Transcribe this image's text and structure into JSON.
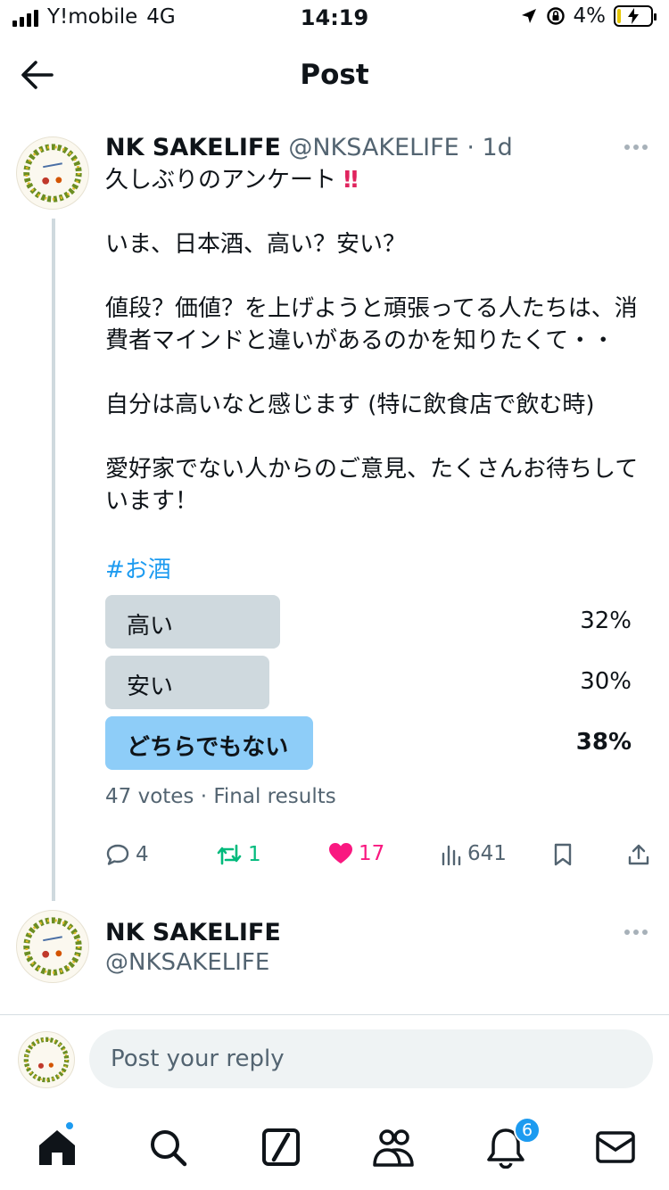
{
  "status_bar": {
    "carrier": "Y!mobile",
    "network": "4G",
    "time": "14:19",
    "battery": "4%"
  },
  "header": {
    "title": "Post",
    "back_icon": "arrow-left-icon"
  },
  "tweet": {
    "name": "NK SAKELIFE",
    "handle": "@NKSAKELIFE",
    "time": "· 1d",
    "lines": [
      "久しぶりのアンケート",
      "いま、日本酒、高い？安い？",
      "値段？価値？を上げようと頑張ってる人たちは、消",
      "費者マインドと違いがあるのかを知りたくて・・",
      "自分は高いなと感じます (特に飲食店で飲む時)",
      "愛好家でない人からのご意見、たくさんお待ちして",
      "います！"
    ],
    "emoji_mark": "‼",
    "hashtag": "#お酒",
    "poll": {
      "options": [
        {
          "label": "高い",
          "percent": "32%",
          "fraction": 0.32
        },
        {
          "label": "安い",
          "percent": "30%",
          "fraction": 0.3
        },
        {
          "label": "どちらでもない",
          "percent": "38%",
          "fraction": 0.38
        }
      ],
      "winner_index": 2,
      "meta": "47 votes · Final results"
    },
    "actions": {
      "replies": "4",
      "reposts": "1",
      "likes": "17",
      "views": "641"
    }
  },
  "tweet2": {
    "name": "NK SAKELIFE",
    "handle": "@NKSAKELIFE"
  },
  "reply": {
    "placeholder": "Post your reply"
  },
  "tabbar": {
    "notifications_badge": "6"
  },
  "colors": {
    "accent": "#1d9bf0",
    "like": "#f91880",
    "repost": "#00ba7c",
    "poll_winner": "#8ecdf8",
    "poll_other": "#cfd9de"
  }
}
